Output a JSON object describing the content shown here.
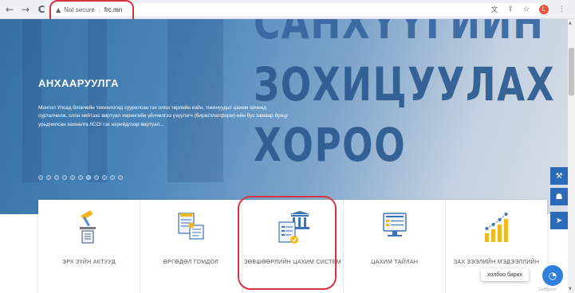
{
  "browser": {
    "back": "←",
    "forward": "→",
    "reload": "C",
    "warning_icon": "▲",
    "security_label": "Not secure",
    "separator": "|",
    "url": "frc.mn",
    "translate_icon": "文",
    "share_icon": "⇪",
    "star_icon": "☆",
    "profile_initial": "L",
    "menu_icon": "⋮"
  },
  "hero": {
    "big_text": [
      "САНХҮҮГИЙН",
      "ЗОХИЦУУЛАХ",
      "ХОРОО"
    ],
    "title": "АНХААРУУЛГА",
    "description": "Монгол Улсад блокчейн технологид суурилсан гэх олон төрлийн койн, токенуудыг цахим орчинд сурталчилж, олон нийтээс виртуал хөрөнгийн үйлчилгээ үзүүлэгч (бирж/платформ)-ийн бус замаар букцу урьдчилсан захиалга /ICO/ гэх нэрийдлээр виртуал...",
    "carousel_count": 11,
    "carousel_active": 6
  },
  "side_buttons": [
    {
      "icon": "gavel-icon",
      "glyph": "⚒"
    },
    {
      "icon": "graduation-cap-icon",
      "glyph": "☗"
    },
    {
      "icon": "paper-plane-icon",
      "glyph": "➤"
    }
  ],
  "cards": [
    {
      "label": "ЭРХ ЗҮЙН АКТУУД",
      "icon": "legal-gavel-icon"
    },
    {
      "label": "ӨРГӨДӨЛ ГОМДОЛ",
      "icon": "complaint-document-icon"
    },
    {
      "label": "ЗӨВШӨӨРЛИЙН ЦАХИМ СИСТЕМ",
      "icon": "bank-license-icon"
    },
    {
      "label": "ЦАХИМ ТАЙЛАН",
      "icon": "computer-report-icon"
    },
    {
      "label": "ЗАХ ЗЭЭЛИЙН МЭДЭЭЛЛИЙН",
      "icon": "market-growth-chart-icon"
    }
  ],
  "chat": {
    "bubble": "холбоо барих",
    "brand": "GetButton",
    "glyph": "◔"
  },
  "colors": {
    "accent": "#2a6ab9",
    "highlight": "#d8343f",
    "gold": "#f1b81d"
  }
}
